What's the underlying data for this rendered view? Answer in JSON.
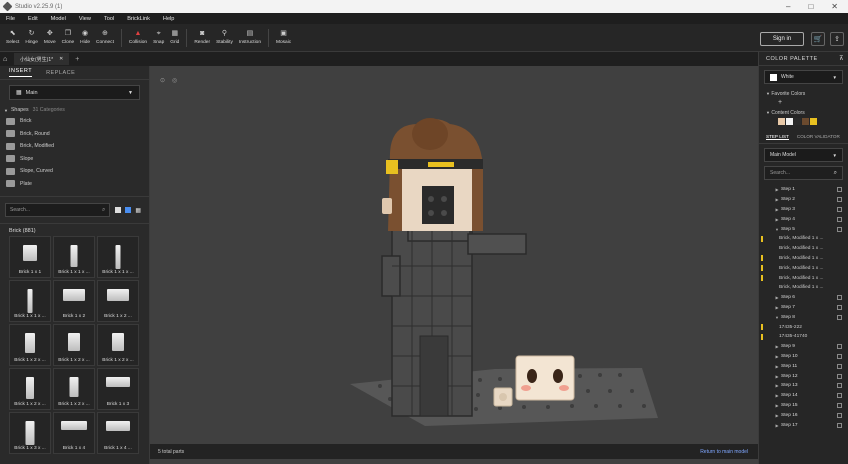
{
  "title": "Studio v2.25.9 (1)",
  "menu": [
    "File",
    "Edit",
    "Model",
    "View",
    "Tool",
    "BrickLink",
    "Help"
  ],
  "toolbar": [
    {
      "label": "Select",
      "icon": "select-icon",
      "glyph": "⬉"
    },
    {
      "label": "Hinge",
      "icon": "hinge-icon",
      "glyph": "↻"
    },
    {
      "label": "Move",
      "icon": "move-icon",
      "glyph": "✥"
    },
    {
      "label": "Clone",
      "icon": "clone-icon",
      "glyph": "❐"
    },
    {
      "label": "Hide",
      "icon": "hide-icon",
      "glyph": "◉"
    },
    {
      "label": "Connect",
      "icon": "connect-icon",
      "glyph": "⊕"
    },
    {
      "label": "Collision",
      "icon": "collision-icon",
      "glyph": "▲"
    },
    {
      "label": "Snap",
      "icon": "snap-icon",
      "glyph": "⌖"
    },
    {
      "label": "Grid",
      "icon": "grid-icon",
      "glyph": "▦"
    },
    {
      "label": "Render",
      "icon": "render-icon",
      "glyph": "◙"
    },
    {
      "label": "Stability",
      "icon": "stability-icon",
      "glyph": "⚲"
    },
    {
      "label": "Instruction",
      "icon": "instruction-icon",
      "glyph": "▤"
    },
    {
      "label": "Mosaic",
      "icon": "mosaic-icon",
      "glyph": "▣"
    }
  ],
  "sign_in": "Sign in",
  "doc_tab": "小仙女(男生)1*",
  "left": {
    "tabs": [
      "INSERT",
      "REPLACE"
    ],
    "palette": "Main",
    "shapes_label": "Shapes",
    "shapes_count": "31 Categories",
    "shapes": [
      "Brick",
      "Brick, Round",
      "Brick, Modified",
      "Slope",
      "Slope, Curved",
      "Plate"
    ],
    "search_placeholder": "Search...",
    "brick_header": "Brick (881)",
    "bricks": [
      "Brick 1 x 1",
      "Brick 1 x 1 x ...",
      "Brick 1 x 1 x ...",
      "Brick 1 x 1 x ...",
      "Brick 1 x 2",
      "Brick 1 x 2 ...",
      "Brick 1 x 2 x ...",
      "Brick 1 x 2 x ...",
      "Brick 1 x 2 x ...",
      "Brick 1 x 2 x ...",
      "Brick 1 x 2 x ...",
      "Brick 1 x 3",
      "Brick 1 x 3 x ...",
      "Brick 1 x 4",
      "Brick 1 x 4 ..."
    ]
  },
  "status": {
    "parts": "5 total parts",
    "return": "Return to main model"
  },
  "right": {
    "palette_title": "COLOR PALETTE",
    "selected_color": "White",
    "favorite": "Favorite Colors",
    "content": "Content Colors",
    "content_colors": [
      "#e8c9a8",
      "#f2f2f2",
      "#2a2a2a",
      "#6b4a2e",
      "#e8c020"
    ],
    "step_tabs": [
      "STEP LIST",
      "COLOR VALIDATOR"
    ],
    "model_select": "Main Model",
    "search_placeholder": "Search...",
    "steps": [
      {
        "t": "Step 1",
        "k": "step"
      },
      {
        "t": "Step 2",
        "k": "step"
      },
      {
        "t": "Step 3",
        "k": "step"
      },
      {
        "t": "Step 4",
        "k": "step"
      },
      {
        "t": "Step 5",
        "k": "step-open"
      },
      {
        "t": "Brick, Modified 1 x ...",
        "k": "sub"
      },
      {
        "t": "Brick, Modified 1 x ...",
        "k": "sub"
      },
      {
        "t": "Brick, Modified 1 x ...",
        "k": "sub"
      },
      {
        "t": "Brick, Modified 1 x ...",
        "k": "sub"
      },
      {
        "t": "Brick, Modified 1 x ...",
        "k": "sub"
      },
      {
        "t": "Brick, Modified 1 x ...",
        "k": "sub"
      },
      {
        "t": "Step 6",
        "k": "step"
      },
      {
        "t": "Step 7",
        "k": "step"
      },
      {
        "t": "Step 8",
        "k": "step-open"
      },
      {
        "t": "17435-222",
        "k": "sub"
      },
      {
        "t": "17435-41740",
        "k": "sub"
      },
      {
        "t": "Step 9",
        "k": "step"
      },
      {
        "t": "Step 10",
        "k": "step"
      },
      {
        "t": "Step 11",
        "k": "step"
      },
      {
        "t": "Step 12",
        "k": "step"
      },
      {
        "t": "Step 13",
        "k": "step"
      },
      {
        "t": "Step 14",
        "k": "step"
      },
      {
        "t": "Step 15",
        "k": "step"
      },
      {
        "t": "Step 16",
        "k": "step"
      },
      {
        "t": "Step 17",
        "k": "step"
      }
    ]
  }
}
